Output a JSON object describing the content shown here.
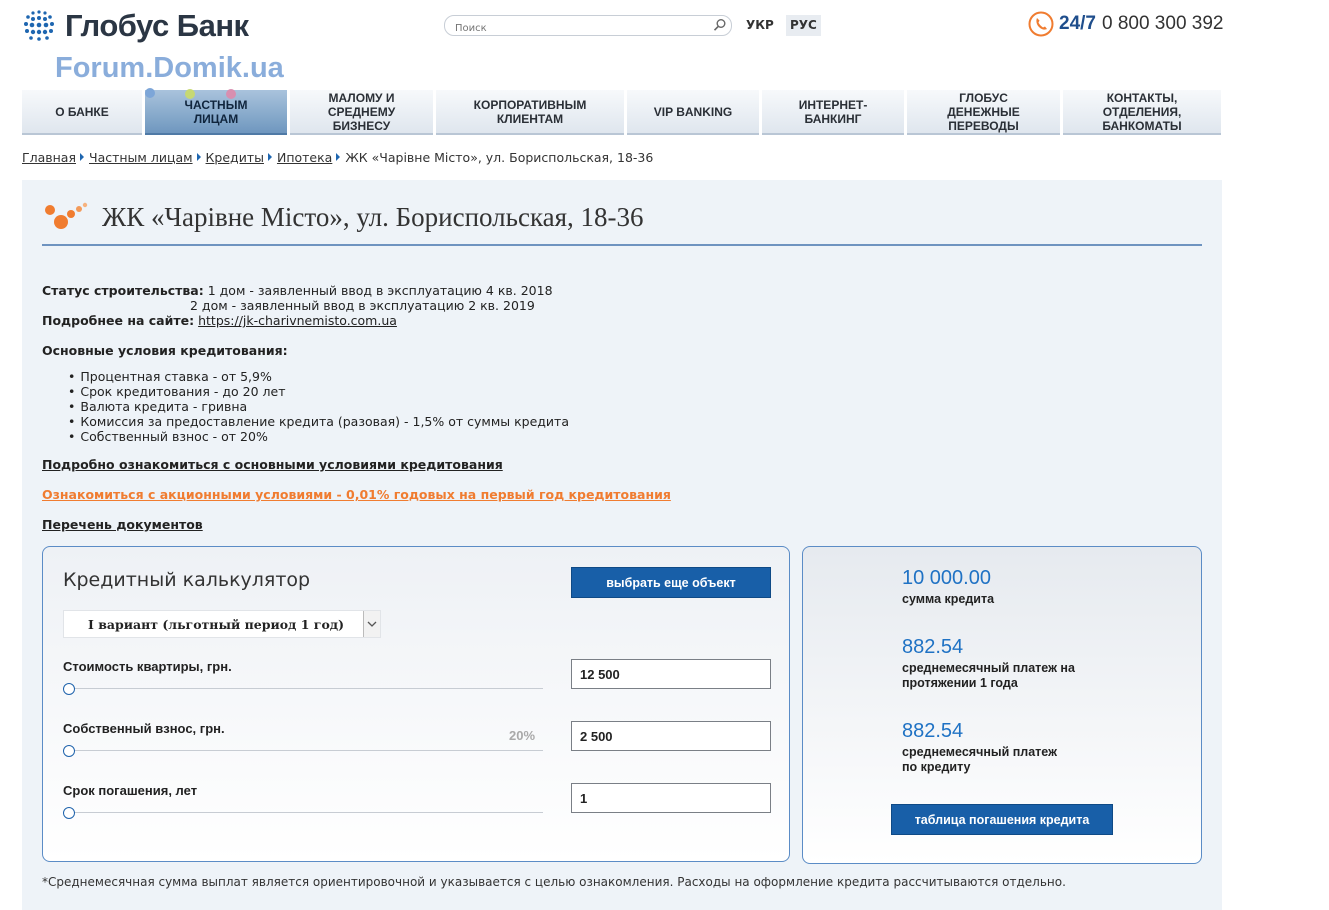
{
  "header": {
    "logo_text": "Глобус Банк",
    "watermark": "Forum.Domik.ua",
    "search_placeholder": "Поиск",
    "lang_ukr": "УКР",
    "lang_rus": "РУС",
    "hotline_247": "24/7",
    "hotline_number": "0 800 300 392"
  },
  "nav": [
    {
      "label": "О БАНКЕ",
      "width": 120,
      "active": false
    },
    {
      "label": "ЧАСТНЫМ ЛИЦАМ",
      "width": 142,
      "active": true
    },
    {
      "label": "МАЛОМУ И СРЕДНЕМУ БИЗНЕСУ",
      "width": 143,
      "active": false
    },
    {
      "label": "КОРПОРАТИВНЫМ КЛИЕНТАМ",
      "width": 188,
      "active": false
    },
    {
      "label": "VIP BANKING",
      "width": 132,
      "active": false
    },
    {
      "label": "ИНТЕРНЕТ-БАНКИНГ",
      "width": 142,
      "active": false
    },
    {
      "label": "ГЛОБУС ДЕНЕЖНЫЕ ПЕРЕВОДЫ",
      "width": 153,
      "active": false
    },
    {
      "label": "КОНТАКТЫ, ОТДЕЛЕНИЯ, БАНКОМАТЫ",
      "width": 158,
      "active": false
    }
  ],
  "breadcrumb": {
    "home": "Главная",
    "private": "Частным лицам",
    "credits": "Кредиты",
    "mortgage": "Ипотека",
    "current": "ЖК «Чарівне Місто», ул. Бориспольская, 18-36"
  },
  "page": {
    "title": "ЖК «Чарівне Місто», ул. Бориспольская, 18-36",
    "status_label": "Статус строительства:",
    "status_line1": "1 дом - заявленный ввод в эксплуатацию 4 кв. 2018",
    "status_line2": "2 дом - заявленный ввод в эксплуатацию 2 кв. 2019",
    "site_label": "Подробнее на сайте:",
    "site_url": "https://jk-charivnemisto.com.ua",
    "conditions_title": "Основные условия кредитования:",
    "conditions": [
      "Процентная ставка - от 5,9%",
      "Срок кредитования - до 20 лет",
      "Валюта кредита - гривна",
      "Комиссия за предоставление кредита (разовая) - 1,5% от суммы кредита",
      "Собственный взнос - от 20%"
    ],
    "link_details": "Подробно ознакомиться с основными условиями кредитования",
    "link_promo": "Ознакомиться с акционными условиями - 0,01% годовых на первый год кредитования",
    "link_docs": "Перечень документов",
    "footnote": "*Среднемесячная сумма выплат является ориентировочной и указывается с целью ознакомления. Расходы на оформление кредита рассчитываются отдельно."
  },
  "calculator": {
    "title": "Кредитный калькулятор",
    "choose_object": "выбрать еще объект",
    "variant": "I вариант (льготный период 1 год)",
    "price_label": "Стоимость квартиры, грн.",
    "price_value": "12 500",
    "down_label": "Собственный взнос, грн.",
    "down_value": "2 500",
    "down_percent": "20%",
    "term_label": "Срок погашения, лет",
    "term_value": "1"
  },
  "results": {
    "amount_value": "10 000.00",
    "amount_label": "сумма кредита",
    "monthly_first_value": "882.54",
    "monthly_first_label_1": "среднемесячный платеж на",
    "monthly_first_label_2": "протяжении 1 года",
    "monthly_value": "882.54",
    "monthly_label_1": "среднемесячный платеж",
    "monthly_label_2": "по кредиту",
    "table_button": "таблица погашения кредита"
  },
  "colors": {
    "brand_blue": "#185fa8",
    "accent_orange": "#f07c30",
    "result_blue": "#1f72c4",
    "panel_bg": "#eef3f8"
  }
}
